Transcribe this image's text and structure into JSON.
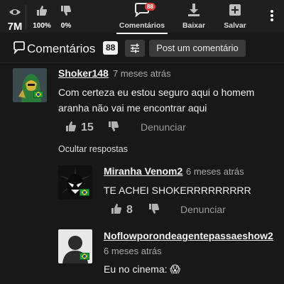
{
  "stats": {
    "views": "7M",
    "likes_pct": "100%",
    "dislikes_pct": "0%"
  },
  "tabs": {
    "comments_label": "Comentários",
    "comments_badge": "88",
    "download_label": "Baixar",
    "save_label": "Salvar"
  },
  "comments_header": {
    "title": "Comentários",
    "count": "88",
    "post_button": "Post um comentário"
  },
  "hide_replies": "Ocultar respostas",
  "report_label": "Denunciar",
  "comments": [
    {
      "author": "Shoker148",
      "time": "7 meses atrás",
      "text": "Com certeza eu estou seguro aqui o homem aranha não vai me encontrar aqui",
      "likes": "15"
    },
    {
      "author": "Miranha Venom2",
      "time": "6 meses atrás",
      "text": "TE ACHEI SHOKERRRRRRRRR",
      "likes": "8"
    },
    {
      "author": "Noflowporondeagentepassaeshow2",
      "time": "6 meses atrás",
      "text": "Eu no cinema: 😱",
      "likes": ""
    }
  ],
  "colors": {
    "background": "#181818",
    "topbar": "#1f1f1f",
    "badge": "#e03c3c",
    "button_bg": "#3a3a3a"
  }
}
